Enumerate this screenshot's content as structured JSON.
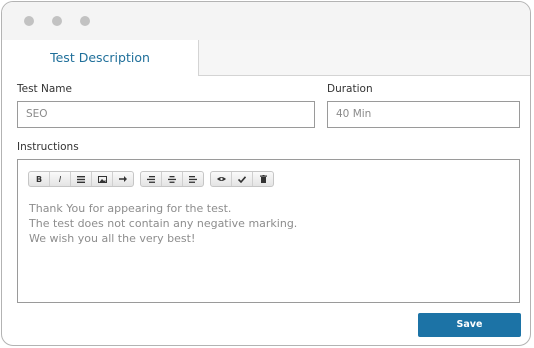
{
  "tabs": [
    {
      "label": "Test Description",
      "active": true
    }
  ],
  "form": {
    "test_name": {
      "label": "Test Name",
      "value": "SEO"
    },
    "duration": {
      "label": "Duration",
      "value": "40 Min"
    },
    "instructions": {
      "label": "Instructions",
      "lines": [
        "Thank You for appearing for the test.",
        "The test does not contain any negative marking.",
        "We wish you all the very best!"
      ]
    }
  },
  "toolbar": {
    "groups": [
      [
        "bold-icon",
        "italic-icon",
        "list-icon",
        "image-icon",
        "arrow-right-icon"
      ],
      [
        "align-right-icon",
        "align-center-icon",
        "align-left-icon"
      ],
      [
        "eye-icon",
        "check-icon",
        "trash-icon"
      ]
    ],
    "glyphs": {
      "bold": "B",
      "italic": "I"
    }
  },
  "actions": {
    "save_label": "Save"
  },
  "colors": {
    "accent": "#1c73a6",
    "tab_text": "#1f6f9a"
  }
}
